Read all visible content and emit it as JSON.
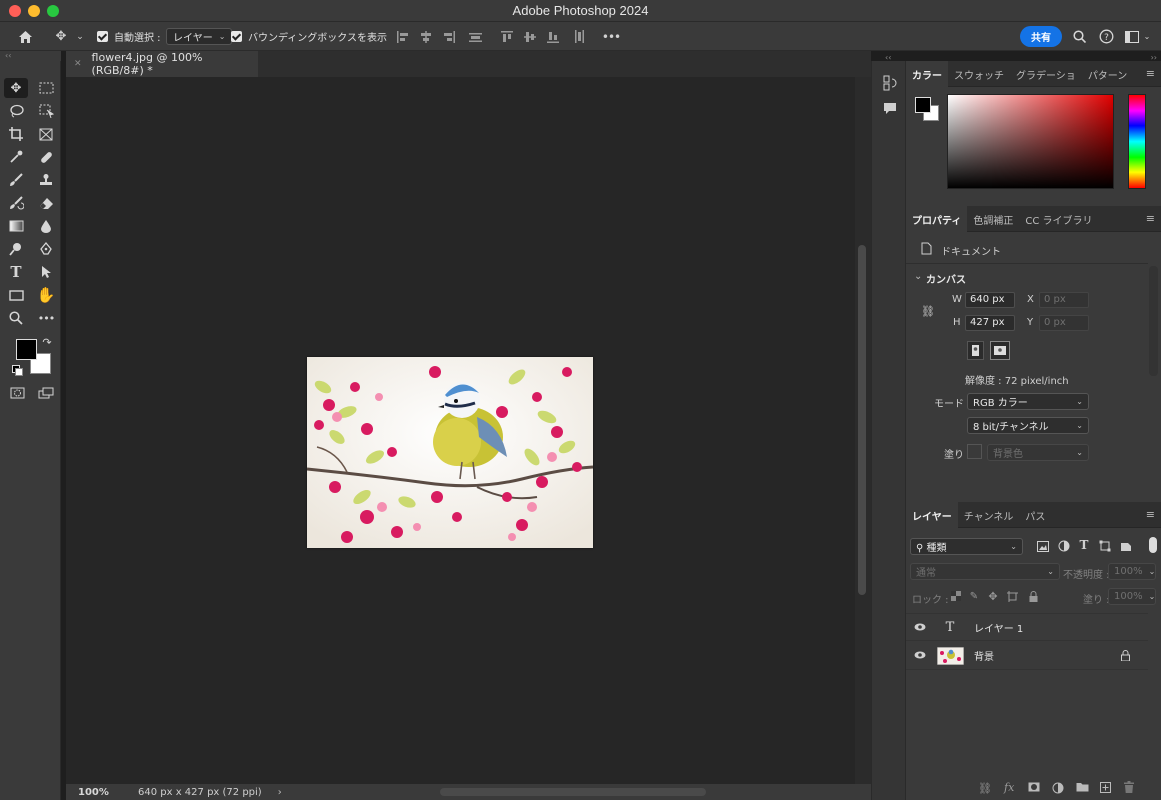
{
  "window": {
    "title": "Adobe Photoshop 2024"
  },
  "options_bar": {
    "auto_select_label": "自動選択 :",
    "auto_select_target": "レイヤー",
    "show_bounding_box_label": "バウンディングボックスを表示",
    "share_label": "共有",
    "more_label": "•••"
  },
  "document_tab": {
    "title": "flower4.jpg @ 100% (RGB/8#) *"
  },
  "status_bar": {
    "zoom": "100%",
    "doc_info": "640 px x 427 px (72 ppi)"
  },
  "color_panel": {
    "tabs": [
      "カラー",
      "スウォッチ",
      "グラデーショ",
      "パターン"
    ],
    "foreground": "#000000",
    "background": "#ffffff"
  },
  "properties_panel": {
    "tabs": [
      "プロパティ",
      "色調補正",
      "CC ライブラリ"
    ],
    "document_label": "ドキュメント",
    "canvas_section": "カンバス",
    "w_label": "W",
    "w_value": "640 px",
    "h_label": "H",
    "h_value": "427 px",
    "x_label": "X",
    "x_placeholder": "0 px",
    "y_label": "Y",
    "y_placeholder": "0 px",
    "resolution": "解像度 : 72 pixel/inch",
    "mode_label": "モード",
    "mode_value": "RGB カラー",
    "bit_depth": "8 bit/チャンネル",
    "fill_label": "塗り",
    "fill_value": "背景色"
  },
  "layers_panel": {
    "tabs": [
      "レイヤー",
      "チャンネル",
      "パス"
    ],
    "filter_kind": "種類",
    "blend_mode": "通常",
    "opacity_label": "不透明度 :",
    "opacity_value": "100%",
    "lock_label": "ロック :",
    "fill_label": "塗り :",
    "fill_value": "100%",
    "layers": [
      {
        "name": "レイヤー 1",
        "type": "text",
        "visible": true
      },
      {
        "name": "背景",
        "type": "image",
        "visible": true,
        "locked": true
      }
    ]
  },
  "tools_icons": [
    "move-tool",
    "marquee-tool",
    "lasso-tool",
    "object-select-tool",
    "crop-tool",
    "frame-tool",
    "eyedropper-tool",
    "healing-brush-tool",
    "brush-tool",
    "stamp-tool",
    "history-brush-tool",
    "eraser-tool",
    "gradient-tool",
    "blur-tool",
    "dodge-tool",
    "pen-tool",
    "type-tool",
    "path-select-tool",
    "rectangle-tool",
    "hand-tool",
    "zoom-tool",
    "more-tools"
  ],
  "accent_color": "#1473e6"
}
